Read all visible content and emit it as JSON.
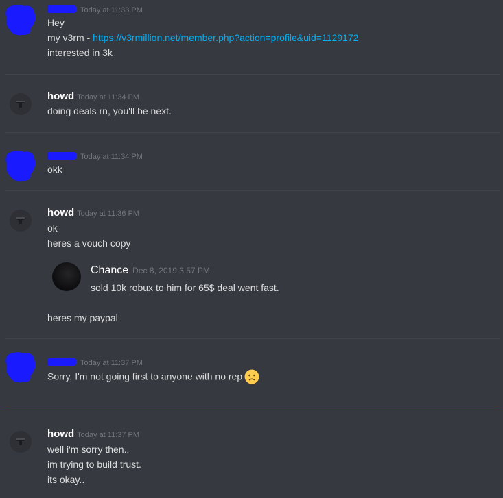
{
  "messages": [
    {
      "author": "",
      "time": "Today at 11:33 PM",
      "lines": [
        "Hey"
      ],
      "link_prefix": "my v3rm - ",
      "link": "https://v3rmillion.net/member.php?action=profile&uid=1129172",
      "extra": "interested in 3k"
    },
    {
      "author": "howd",
      "time": "Today at 11:34 PM",
      "lines": [
        "doing deals rn, you'll be next."
      ]
    },
    {
      "author": "",
      "time": "Today at 11:34 PM",
      "lines": [
        "okk"
      ]
    },
    {
      "author": "howd",
      "time": "Today at 11:36 PM",
      "lines": [
        "ok",
        "heres a vouch copy"
      ],
      "quote": {
        "name": "Chance",
        "time": "Dec 8, 2019 3:57 PM",
        "text": "sold 10k robux to him for 65$ deal went fast."
      },
      "after": "heres my paypal"
    },
    {
      "author": "",
      "time": "Today at 11:37 PM",
      "lines": [
        "Sorry, I'm not going first to anyone with no rep"
      ],
      "emoji": "frowning-face"
    },
    {
      "author": "howd",
      "time": "Today at 11:37 PM",
      "lines": [
        "well i'm sorry then..",
        "im trying to build trust.",
        "its okay.."
      ]
    }
  ],
  "colors": {
    "background": "#36393f",
    "link": "#00b0f4",
    "new_divider": "#e34c4c",
    "redaction": "#1a1aff"
  }
}
